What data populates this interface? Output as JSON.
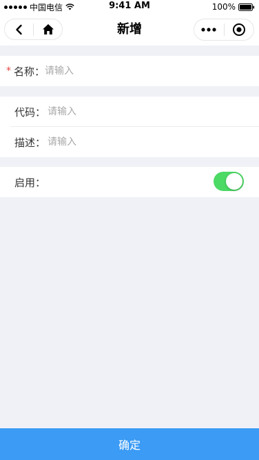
{
  "status_bar": {
    "carrier": "中国电信",
    "time": "9:41 AM",
    "battery": "100%"
  },
  "nav": {
    "title": "新增",
    "back_icon": "back-chevron-icon",
    "home_icon": "home-icon",
    "more_icon": "more-dots-icon",
    "close_icon": "target-circle-icon"
  },
  "form": {
    "name": {
      "label": "名称：",
      "placeholder": "请输入",
      "required_mark": "*"
    },
    "code": {
      "label": "代码：",
      "placeholder": "请输入"
    },
    "description": {
      "label": "描述：",
      "placeholder": "请输入"
    },
    "enabled": {
      "label": "启用：",
      "value": true
    }
  },
  "colors": {
    "accent": "#3b9bf5",
    "switch_on": "#4cd964",
    "required": "#e64340",
    "background": "#eff1f6"
  },
  "submit": {
    "label": "确定"
  }
}
